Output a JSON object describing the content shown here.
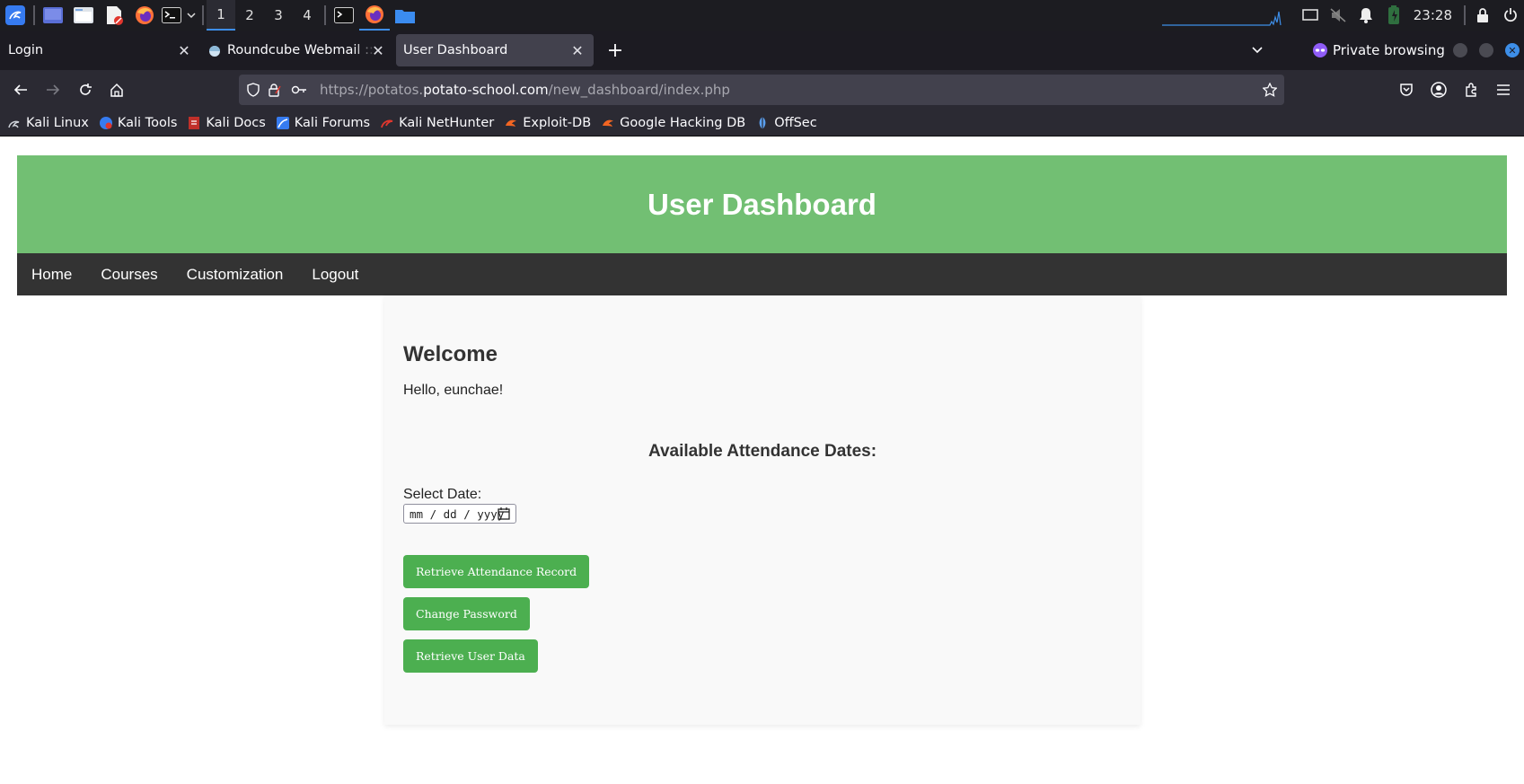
{
  "taskbar": {
    "workspaces": [
      "1",
      "2",
      "3",
      "4"
    ],
    "clock": "23:28",
    "icons": [
      "kali-menu-icon",
      "desktop-icon",
      "file-manager-icon",
      "text-editor-icon",
      "firefox-icon",
      "terminal-icon",
      "chevron-down-icon",
      "terminal-window-icon",
      "firefox-window-icon",
      "folder-window-icon",
      "cpu-graph-icon",
      "display-icon",
      "mute-icon",
      "notification-bell-icon",
      "battery-icon",
      "lock-icon",
      "power-icon"
    ]
  },
  "tabs": [
    {
      "title": "Login",
      "favicon": "none",
      "active": false
    },
    {
      "title": "Roundcube Webmail :: Inbox",
      "favicon": "roundcube-icon",
      "active": false
    },
    {
      "title": "User Dashboard",
      "favicon": "none",
      "active": true
    }
  ],
  "browser": {
    "private_label": "Private browsing",
    "url_prefix": "https://potatos.",
    "url_domain": "potato-school.com",
    "url_path": "/new_dashboard/index.php"
  },
  "bookmarks": [
    {
      "label": "Kali Linux",
      "icon": "kali-linux-icon"
    },
    {
      "label": "Kali Tools",
      "icon": "kali-tools-icon"
    },
    {
      "label": "Kali Docs",
      "icon": "kali-docs-icon"
    },
    {
      "label": "Kali Forums",
      "icon": "kali-forums-icon"
    },
    {
      "label": "Kali NetHunter",
      "icon": "kali-nethunter-icon"
    },
    {
      "label": "Exploit-DB",
      "icon": "exploit-db-icon"
    },
    {
      "label": "Google Hacking DB",
      "icon": "google-hacking-db-icon"
    },
    {
      "label": "OffSec",
      "icon": "offsec-icon"
    }
  ],
  "page": {
    "header_title": "User Dashboard",
    "nav": [
      "Home",
      "Courses",
      "Customization",
      "Logout"
    ],
    "welcome_heading": "Welcome",
    "greeting": "Hello, eunchae!",
    "dates_heading": "Available Attendance Dates:",
    "select_label": "Select Date:",
    "date_placeholder": "mm / dd / yyyy",
    "buttons": [
      "Retrieve Attendance Record",
      "Change Password",
      "Retrieve User Data"
    ],
    "colors": {
      "header_green": "#72bf73",
      "nav_dark": "#333333",
      "button_green": "#4caf50"
    }
  }
}
